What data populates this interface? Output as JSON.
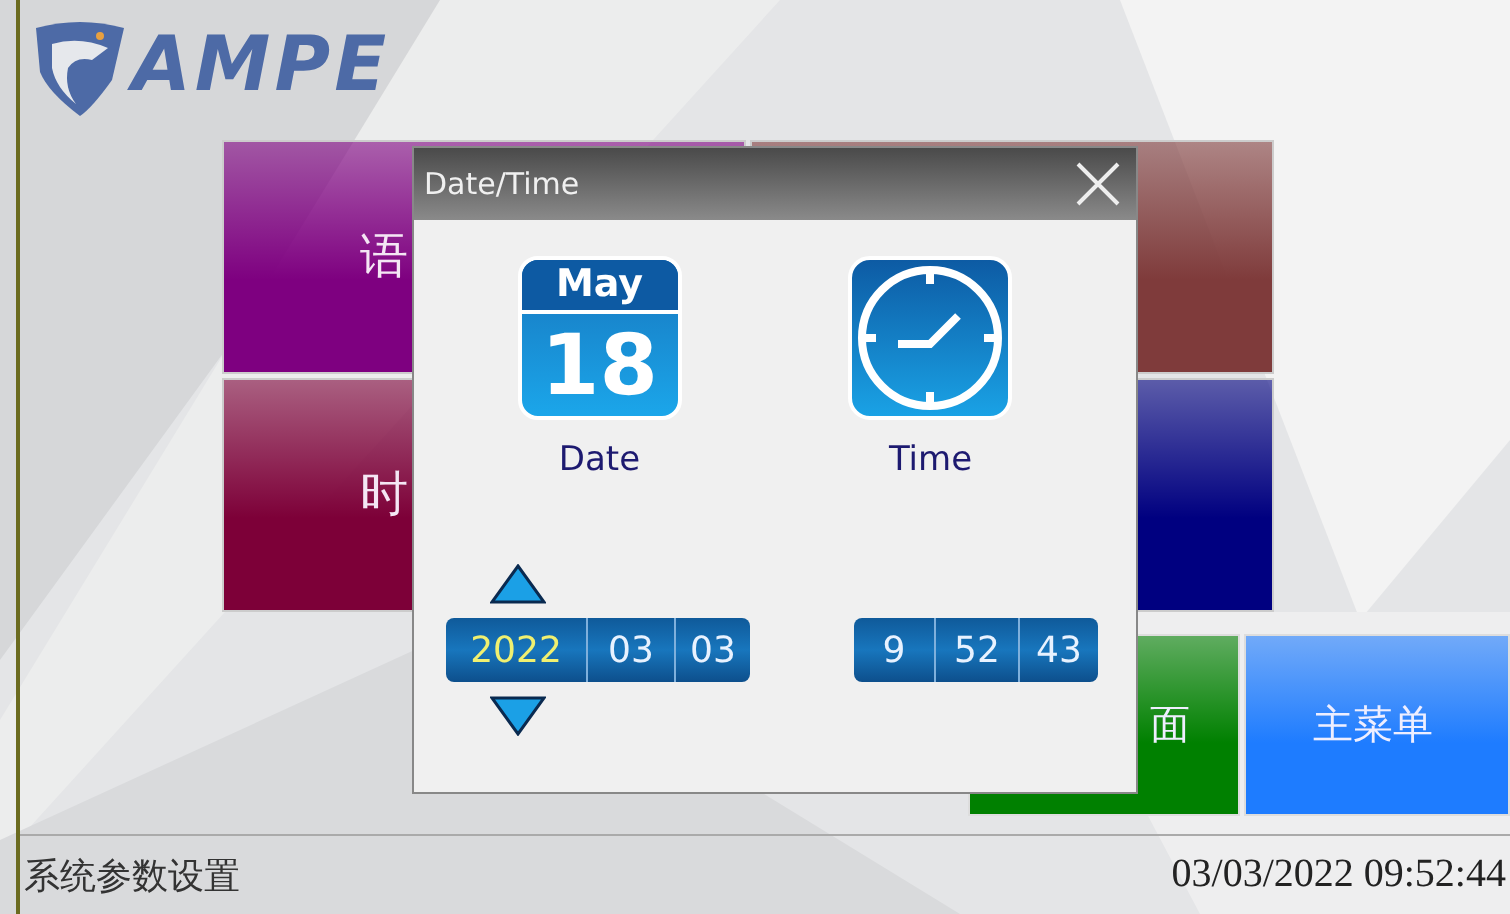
{
  "logo": {
    "text": "AMPE"
  },
  "tiles": [
    {
      "label": "语",
      "color": "#7e0080"
    },
    {
      "color": "#7f3b3b"
    },
    {
      "label": "时",
      "color": "#7d0038"
    },
    {
      "color": "#000080"
    }
  ],
  "bottom_tiles": [
    {
      "label": "面",
      "color": "#008000"
    },
    {
      "label": "主菜单",
      "color": "#1e7cff"
    }
  ],
  "dialog": {
    "title": "Date/Time",
    "date_icon": {
      "month": "May",
      "day": "18"
    },
    "date_label": "Date",
    "time_label": "Time",
    "date_fields": [
      {
        "value": "2022",
        "selected": true
      },
      {
        "value": "03",
        "selected": false
      },
      {
        "value": "03",
        "selected": false
      }
    ],
    "time_fields": [
      {
        "value": "9",
        "selected": false
      },
      {
        "value": "52",
        "selected": false
      },
      {
        "value": "43",
        "selected": false
      }
    ]
  },
  "status_bar": {
    "title": "系统参数设置",
    "datetime": "03/03/2022 09:52:44"
  }
}
